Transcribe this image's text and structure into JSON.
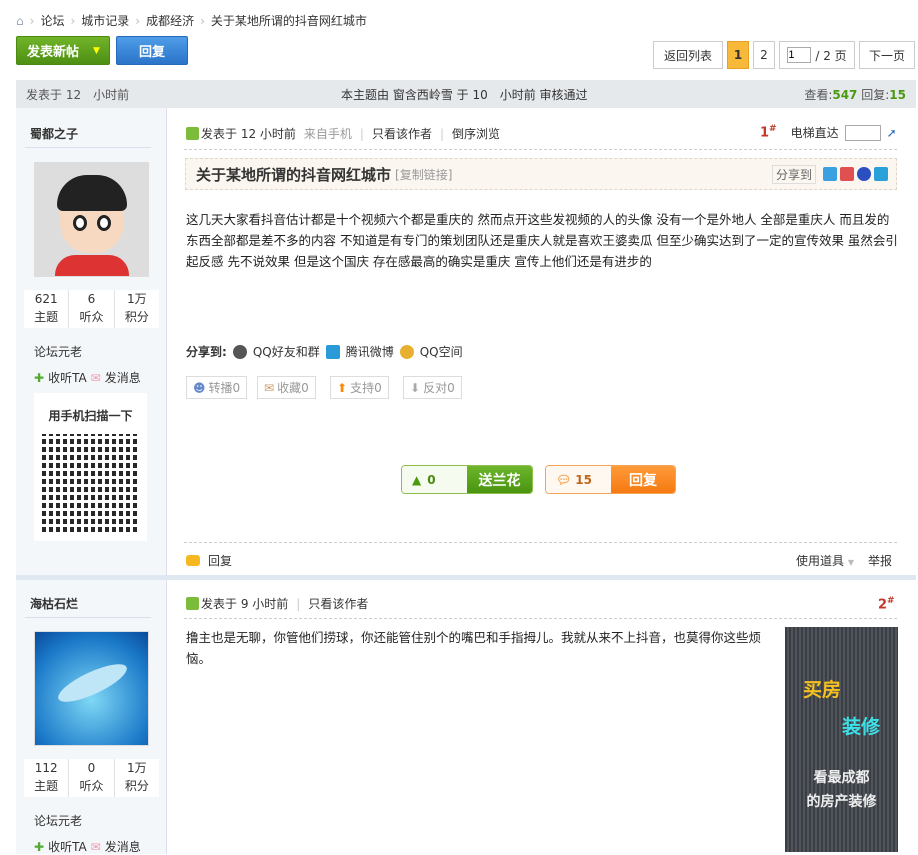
{
  "breadcrumb": [
    "论坛",
    "城市记录",
    "成都经济",
    "关于某地所谓的抖音网红城市"
  ],
  "toolbar": {
    "new_post": "发表新帖",
    "reply": "回复"
  },
  "pager": {
    "back": "返回列表",
    "pages": [
      "1",
      "2"
    ],
    "current": "1",
    "total": "/ 2 页",
    "next": "下一页"
  },
  "thread_bar": {
    "posted": "发表于 12　小时前",
    "moderation": "本主题由 窗含西岭雪 于 10　小时前 审核通过",
    "views_label": "查看:",
    "views": "547",
    "replies_label": "回复:",
    "replies": "15"
  },
  "posts": [
    {
      "author": "蜀都之子",
      "stats": [
        {
          "v": "621",
          "l": "主题"
        },
        {
          "v": "6",
          "l": "听众"
        },
        {
          "v": "1万",
          "l": "积分"
        }
      ],
      "rank": "论坛元老",
      "follow": "收听TA",
      "message": "发消息",
      "qr_title": "用手机扫描一下",
      "posted": "发表于 12 小时前",
      "from": "来自手机",
      "only_author": "只看该作者",
      "reverse": "倒序浏览",
      "floor": "1",
      "elevator": "电梯直达",
      "title": "关于某地所谓的抖音网红城市",
      "copy_link": "[复制链接]",
      "share_to": "分享到",
      "body": "这几天大家看抖音估计都是十个视频六个都是重庆的 然而点开这些发视频的人的头像 没有一个是外地人 全部是重庆人 而且发的东西全部都是差不多的内容 不知道是有专门的策划团队还是重庆人就是喜欢王婆卖瓜 但至少确实达到了一定的宣传效果 虽然会引起反感 先不说效果 但是这个国庆 存在感最高的确实是重庆 宣传上他们还是有进步的",
      "share_label": "分享到:",
      "share_items": [
        "QQ好友和群",
        "腾讯微博",
        "QQ空间"
      ],
      "votes": [
        "转播0",
        "收藏0",
        "支持0",
        "反对0"
      ],
      "flower_count": "0",
      "flower_btn": "送兰花",
      "reply_count": "15",
      "reply_btn": "回复",
      "foot_reply": "回复",
      "tools": "使用道具",
      "report": "举报"
    },
    {
      "author": "海枯石烂",
      "stats": [
        {
          "v": "112",
          "l": "主题"
        },
        {
          "v": "0",
          "l": "听众"
        },
        {
          "v": "1万",
          "l": "积分"
        }
      ],
      "rank": "论坛元老",
      "follow": "收听TA",
      "message": "发消息",
      "posted": "发表于 9 小时前",
      "only_author": "只看该作者",
      "floor": "2",
      "body": "撸主也是无聊，你管他们捞球，你还能管住别个的嘴巴和手指拇儿。我就从来不上抖音，也莫得你这些烦恼。"
    }
  ],
  "ad": {
    "line1": "买房",
    "line2": "装修",
    "line3": "看最成都",
    "line4": "的房产装修"
  }
}
